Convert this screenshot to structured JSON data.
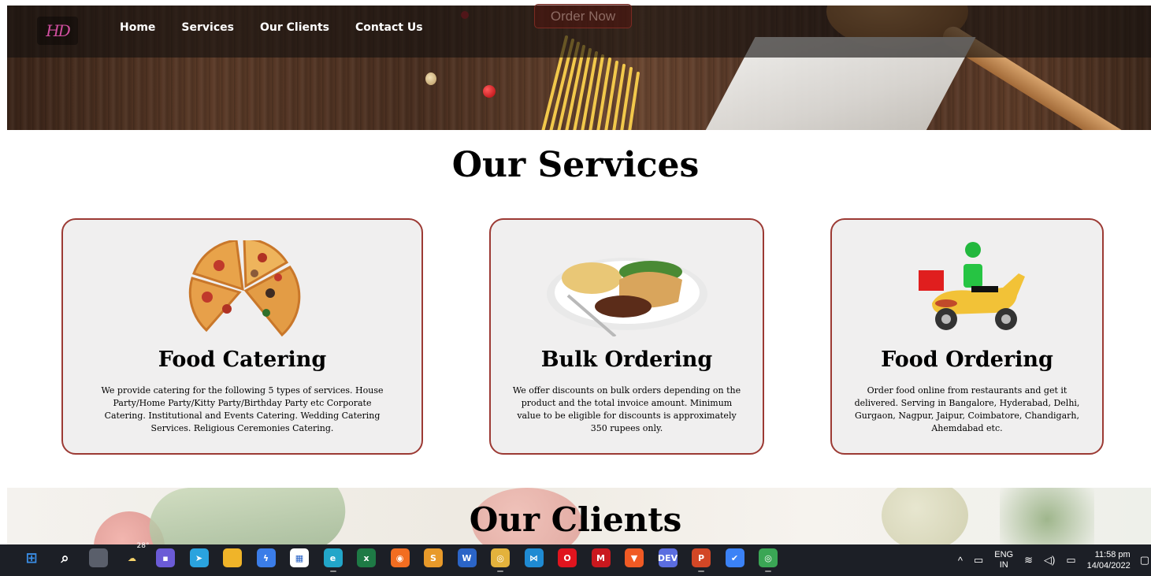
{
  "nav": {
    "logo_text": "HD",
    "links": [
      "Home",
      "Services",
      "Our Clients",
      "Contact Us"
    ],
    "order_button": "Order Now"
  },
  "services": {
    "title": "Our Services",
    "cards": [
      {
        "title": "Food Catering",
        "description": "We provide catering for the following 5 types of services. House Party/Home Party/Kitty Party/Birthday Party etc Corporate Catering. Institutional and Events Catering. Wedding Catering Services. Religious Ceremonies Catering."
      },
      {
        "title": "Bulk Ordering",
        "description": "We offer discounts on bulk orders depending on the product and the total invoice amount. Minimum value to be eligible for discounts is approximately 350 rupees only."
      },
      {
        "title": "Food Ordering",
        "description": "Order food online from restaurants and get it delivered. Serving in Bangalore, Hyderabad, Delhi, Gurgaon, Nagpur, Jaipur, Coimbatore, Chandigarh, Ahemdabad etc."
      }
    ]
  },
  "clients": {
    "title": "Our Clients"
  },
  "taskbar": {
    "weather_temp": "28°",
    "apps": [
      {
        "name": "start-icon",
        "color": "#3a8ee6",
        "glyph": "⊞"
      },
      {
        "name": "search-icon",
        "color": "transparent",
        "glyph": "⌕"
      },
      {
        "name": "task-view-icon",
        "color": "#5a5f6b",
        "glyph": ""
      },
      {
        "name": "weather-icon",
        "color": "transparent",
        "glyph": "☁"
      },
      {
        "name": "chat-icon",
        "color": "#6b5bd6",
        "glyph": "▪"
      },
      {
        "name": "telegram-icon",
        "color": "#2aa3de",
        "glyph": "➤"
      },
      {
        "name": "file-explorer-icon",
        "color": "#f0b429",
        "glyph": ""
      },
      {
        "name": "power-automate-icon",
        "color": "#3b7de8",
        "glyph": "ϟ"
      },
      {
        "name": "store-icon",
        "color": "#ffffff",
        "glyph": "▦"
      },
      {
        "name": "edge-icon",
        "color": "#22a6c9",
        "glyph": "e"
      },
      {
        "name": "excel-icon",
        "color": "#1e7a45",
        "glyph": "x"
      },
      {
        "name": "firefox-icon",
        "color": "#f26d21",
        "glyph": "◉"
      },
      {
        "name": "sublime-icon",
        "color": "#e89a2a",
        "glyph": "S"
      },
      {
        "name": "word-icon",
        "color": "#2b65c7",
        "glyph": "W"
      },
      {
        "name": "chrome-canary-icon",
        "color": "#e3b23c",
        "glyph": "◎"
      },
      {
        "name": "vscode-icon",
        "color": "#1f8ad2",
        "glyph": "⋈"
      },
      {
        "name": "opera-icon",
        "color": "#e0141e",
        "glyph": "O"
      },
      {
        "name": "mcafee-icon",
        "color": "#c9181e",
        "glyph": "M"
      },
      {
        "name": "brave-icon",
        "color": "#f05a24",
        "glyph": "▼"
      },
      {
        "name": "dev-icon",
        "color": "#5b6de0",
        "glyph": "DEV"
      },
      {
        "name": "powerpoint-icon",
        "color": "#d24726",
        "glyph": "P"
      },
      {
        "name": "todo-icon",
        "color": "#3b82f6",
        "glyph": "✔"
      },
      {
        "name": "chrome-icon",
        "color": "#3aa655",
        "glyph": "◎"
      }
    ],
    "tray": {
      "chevron": "^",
      "language_line1": "ENG",
      "language_line2": "IN",
      "time": "11:58 pm",
      "date": "14/04/2022"
    }
  }
}
